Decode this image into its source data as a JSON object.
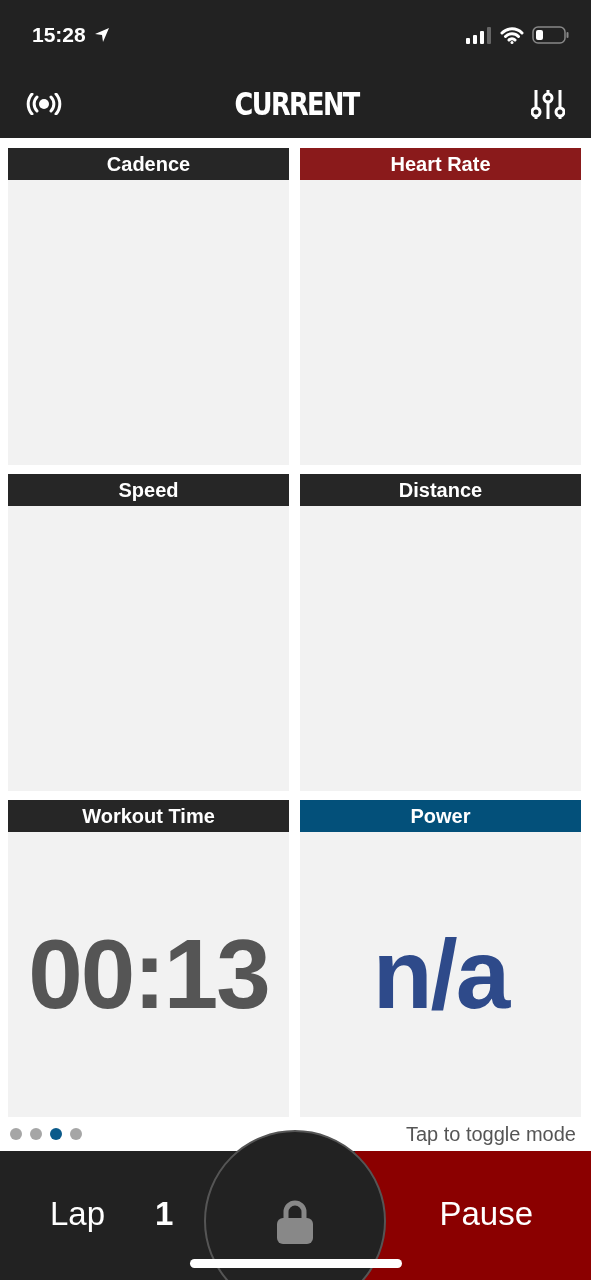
{
  "status_bar": {
    "time": "15:28"
  },
  "header": {
    "title": "CURRENT"
  },
  "tiles": [
    {
      "label": "Cadence",
      "color": "#262626"
    },
    {
      "label": "Heart Rate",
      "color": "#8a1a1b"
    },
    {
      "label": "Speed",
      "color": "#262626"
    },
    {
      "label": "Distance",
      "color": "#262626"
    },
    {
      "label": "Workout Time",
      "color": "#262626",
      "value": "00:13",
      "kind": "reading"
    },
    {
      "label": "Power",
      "color": "#03507a",
      "value": "n/a",
      "kind": "unavailable"
    }
  ],
  "pager": {
    "dots": [
      {
        "selected": false
      },
      {
        "selected": false
      },
      {
        "selected": true
      },
      {
        "selected": false
      }
    ],
    "hint": "Tap to toggle mode"
  },
  "bottom_bar": {
    "lap_label": "Lap",
    "lap_number": "1",
    "pause": "Pause"
  }
}
